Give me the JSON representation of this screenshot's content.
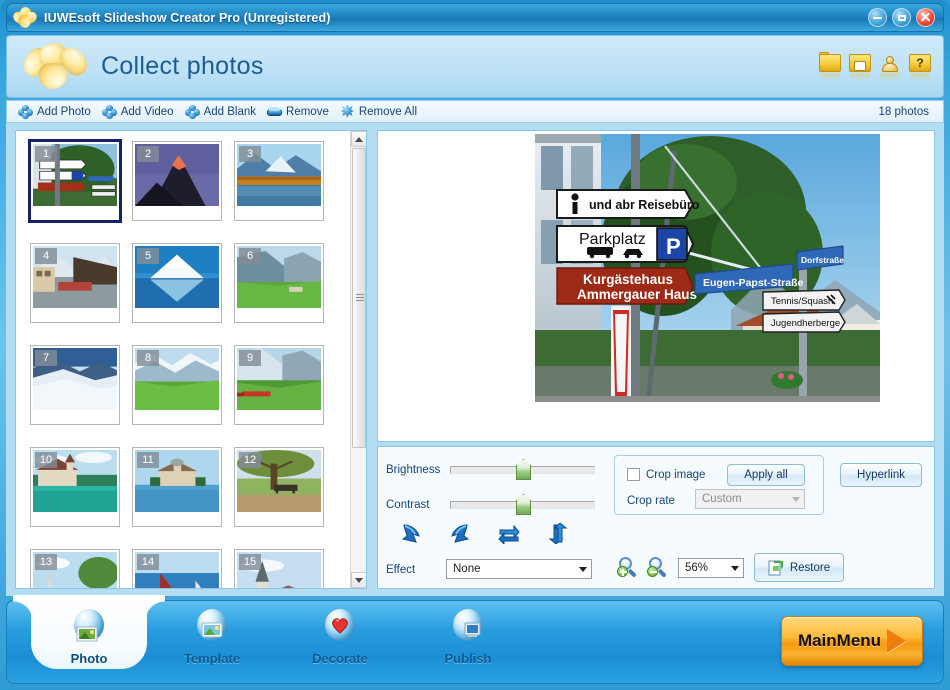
{
  "window": {
    "title": "IUWEsoft Slideshow Creator Pro (Unregistered)",
    "logo_icon": "flower-logo-icon",
    "minimize_icon": "minimize-icon",
    "maximize_icon": "maximize-icon",
    "close_icon": "close-icon"
  },
  "header": {
    "page_title": "Collect photos",
    "brand_icon": "flower-logo-icon",
    "icons": [
      {
        "name": "open-project-icon",
        "glyph": ""
      },
      {
        "name": "save-project-icon",
        "glyph": ""
      },
      {
        "name": "register-user-icon",
        "glyph": ""
      },
      {
        "name": "help-icon",
        "glyph": "?"
      }
    ]
  },
  "toolbar": {
    "buttons": [
      {
        "label": "Add Photo",
        "icon": "add-photo-puzzle-icon"
      },
      {
        "label": "Add Video",
        "icon": "add-video-puzzle-icon"
      },
      {
        "label": "Add Blank",
        "icon": "add-blank-puzzle-icon"
      },
      {
        "label": "Remove",
        "icon": "remove-eraser-icon"
      },
      {
        "label": "Remove All",
        "icon": "remove-all-star-icon"
      }
    ],
    "photo_count": "18 photos"
  },
  "thumbnails": {
    "selected_index": 1,
    "items": [
      {
        "number": "1",
        "caption": "Street signs Ammergauer Haus"
      },
      {
        "number": "2",
        "caption": "Matterhorn at sunrise"
      },
      {
        "number": "3",
        "caption": "Autumn lake reflection"
      },
      {
        "number": "4",
        "caption": "Alpine village street"
      },
      {
        "number": "5",
        "caption": "Mountain mirrored in lake"
      },
      {
        "number": "6",
        "caption": "Green valley cliffs"
      },
      {
        "number": "7",
        "caption": "Snow glacier ridge"
      },
      {
        "number": "8",
        "caption": "Meadow and snowy peaks"
      },
      {
        "number": "9",
        "caption": "Red train in valley"
      },
      {
        "number": "10",
        "caption": "Castle on turquoise lake"
      },
      {
        "number": "11",
        "caption": "Chillon castle island"
      },
      {
        "number": "12",
        "caption": "Park bench under tree"
      },
      {
        "number": "13",
        "caption": "Lakeside tree"
      },
      {
        "number": "14",
        "caption": "Sailboat on blue water"
      },
      {
        "number": "15",
        "caption": "Church spire skyline"
      }
    ],
    "scrollbar": {
      "up_icon": "scroll-up-arrow-icon",
      "down_icon": "scroll-down-arrow-icon"
    }
  },
  "preview": {
    "image_name": "street-signpost-photo",
    "signs": [
      {
        "text": "und abr Reisebüro",
        "style": "white"
      },
      {
        "text": "Parkplatz",
        "style": "white"
      },
      {
        "text": "P",
        "style": "blue-square"
      },
      {
        "text": "Kurgästehaus",
        "style": "red"
      },
      {
        "text": "Ammergauer Haus",
        "style": "red"
      },
      {
        "text": "Eugen-Papst-Straße",
        "style": "blue"
      },
      {
        "text": "Dorfstraße",
        "style": "blue"
      },
      {
        "text": "Tennis/Squash",
        "style": "white"
      },
      {
        "text": "Jugendherberge",
        "style": "white"
      }
    ]
  },
  "edit": {
    "brightness_label": "Brightness",
    "brightness_value": 50,
    "contrast_label": "Contrast",
    "contrast_value": 50,
    "rotate_buttons": [
      {
        "name": "rotate-left-icon"
      },
      {
        "name": "rotate-right-icon"
      },
      {
        "name": "flip-horizontal-icon"
      },
      {
        "name": "flip-vertical-icon"
      }
    ],
    "effect_label": "Effect",
    "effect_value": "None",
    "crop_image_label": "Crop image",
    "crop_image_checked": false,
    "apply_all_label": "Apply all",
    "crop_rate_label": "Crop rate",
    "crop_rate_value": "Custom",
    "crop_rate_enabled": false,
    "hyperlink_label": "Hyperlink",
    "zoom_in_icon": "zoom-in-icon",
    "zoom_out_icon": "zoom-out-icon",
    "zoom_value": "56%",
    "restore_label": "Restore",
    "restore_icon": "restore-icon"
  },
  "nav": {
    "items": [
      {
        "label": "Photo",
        "icon": "photo-nav-icon",
        "active": true
      },
      {
        "label": "Template",
        "icon": "template-nav-icon",
        "active": false
      },
      {
        "label": "Decorate",
        "icon": "decorate-nav-icon",
        "active": false
      },
      {
        "label": "Publish",
        "icon": "publish-nav-icon",
        "active": false
      }
    ],
    "main_menu_label": "MainMenu",
    "main_menu_arrow_icon": "play-arrow-icon"
  },
  "colors": {
    "accent_blue": "#1f85c4",
    "panel_blue": "#b3ddf3",
    "header_blue": "#bfe2f6",
    "title_text": "#1d5c92",
    "orange": "#f59a12",
    "selection": "#16216b"
  }
}
